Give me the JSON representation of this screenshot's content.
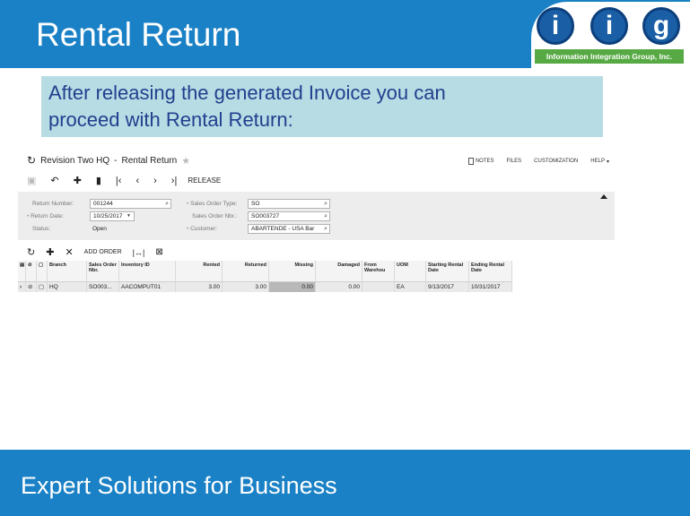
{
  "slide": {
    "title": "Rental Return",
    "callout_lines": [
      "After releasing the generated Invoice you can",
      "proceed with Rental Return:"
    ],
    "footer": "Expert Solutions for Business"
  },
  "logo": {
    "letters": [
      "i",
      "i",
      "g"
    ],
    "tagline": "Information Integration Group, Inc."
  },
  "colors": {
    "header_blue": "#1a81c6",
    "callout_bg": "#b7dce4",
    "callout_text": "#213f8e",
    "logo_green": "#57a944"
  },
  "app": {
    "breadcrumb": {
      "company": "Revision Two HQ",
      "separator": "-",
      "screen": "Rental Return"
    },
    "right_links": {
      "notes": "NOTES",
      "files": "FILES",
      "customization": "CUSTOMIZATION",
      "help": "HELP"
    },
    "toolbar": {
      "release": "RELEASE",
      "icons": [
        "save-icon",
        "undo-icon",
        "add-icon",
        "delete-icon",
        "first-icon",
        "previous-icon",
        "next-icon",
        "last-icon"
      ]
    },
    "form": {
      "return_number_label": "Return Number:",
      "return_number": "001244",
      "return_date_label": "Return Date:",
      "return_date": "10/25/2017",
      "status_label": "Status:",
      "status": "Open",
      "sales_order_type_label": "Sales Order Type:",
      "sales_order_type": "SO",
      "sales_order_nbr_label": "Sales Order Nbr.:",
      "sales_order_nbr": "SO003727",
      "customer_label": "Customer:",
      "customer": "ABARTENDE - USA Bar"
    },
    "grid_toolbar": {
      "add_order": "ADD ORDER"
    },
    "grid": {
      "headers": {
        "branch": "Branch",
        "sales_order_nbr": "Sales Order Nbr.",
        "inventory_id": "Inventory ID",
        "rented": "Rented",
        "returned": "Returned",
        "missing": "Missing",
        "damaged": "Damaged",
        "from_warehouse": "From Warehou",
        "uom": "UOM",
        "starting_rental_date": "Starting Rental Date",
        "ending_rental_date": "Ending Rental Date"
      },
      "rows": [
        {
          "branch": "HQ",
          "sales_order_nbr": "SO003...",
          "inventory_id": "AACOMPUT01",
          "rented": "3.00",
          "returned": "3.00",
          "missing": "0.00",
          "damaged": "0.00",
          "from_warehouse": "",
          "uom": "EA",
          "starting_rental_date": "9/13/2017",
          "ending_rental_date": "10/31/2017"
        }
      ]
    }
  }
}
